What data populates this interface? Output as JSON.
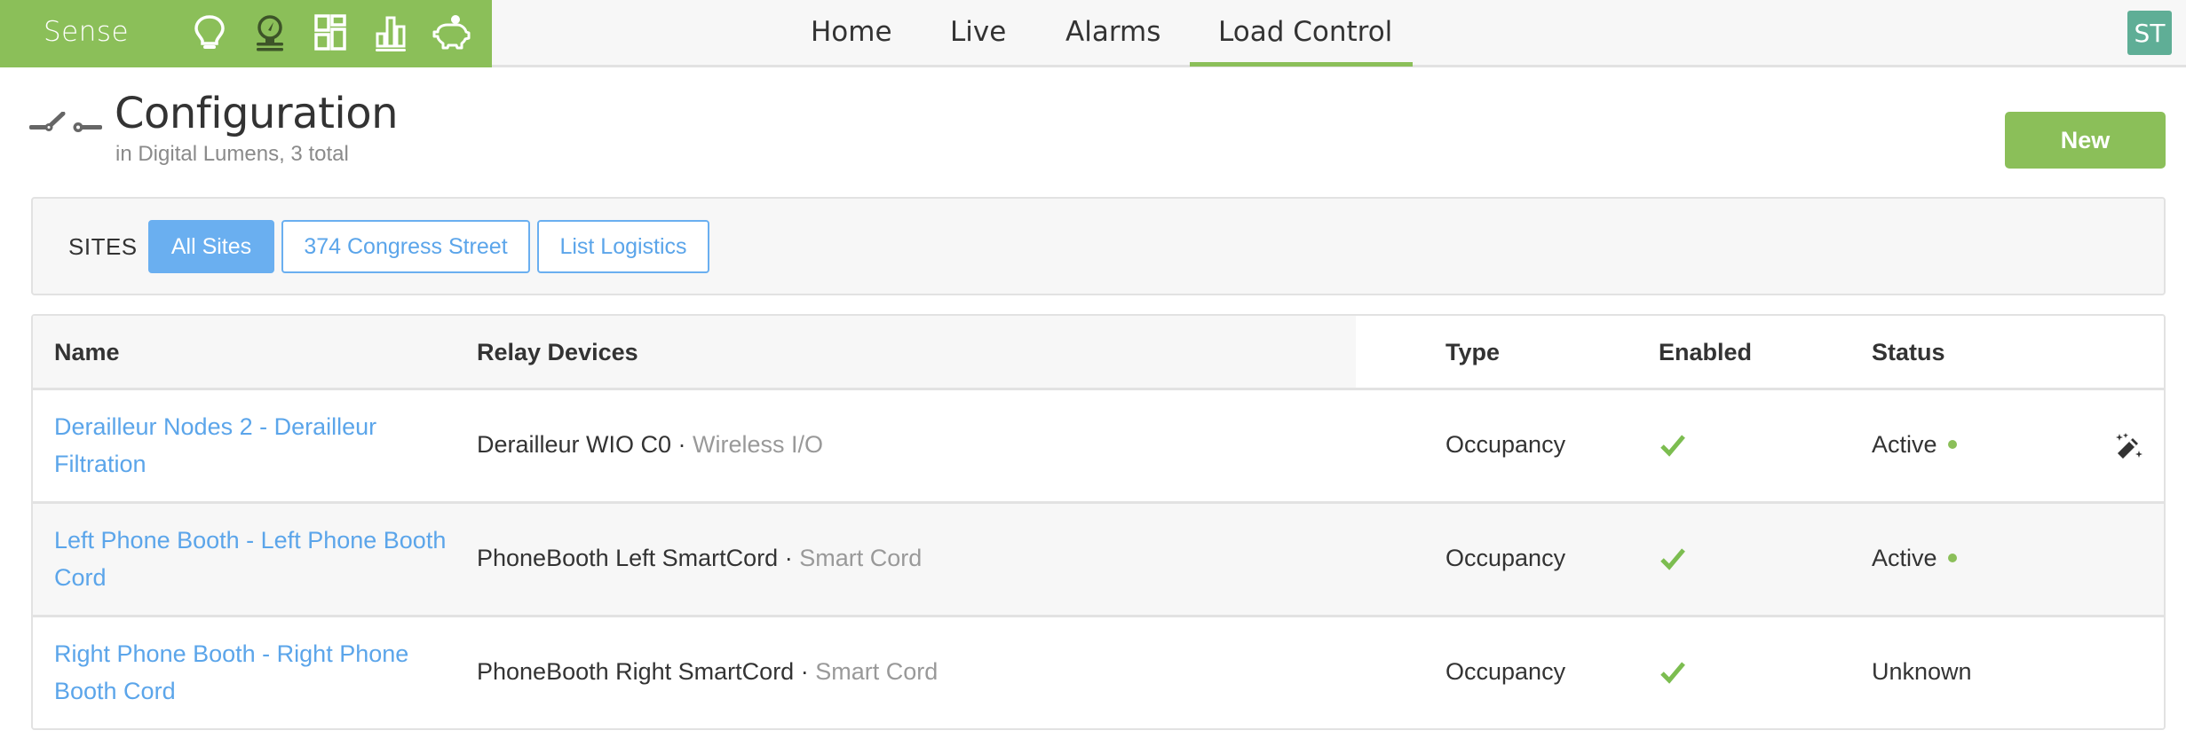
{
  "app": {
    "brand": "Sense",
    "brand_color": "#8bbf59",
    "nav_icons": [
      "lightbulb-icon",
      "gauge-icon",
      "dashboard-grid-icon",
      "bar-chart-icon",
      "piggy-bank-icon"
    ],
    "active_nav_icon": "gauge-icon"
  },
  "nav": {
    "links": [
      {
        "label": "Home"
      },
      {
        "label": "Live"
      },
      {
        "label": "Alarms"
      },
      {
        "label": "Load Control"
      }
    ],
    "active": "Load Control"
  },
  "user": {
    "initials": "ST",
    "avatar_color": "#5fae96"
  },
  "page": {
    "icon": "switch-icon",
    "title": "Configuration",
    "subtitle": "in Digital Lumens, 3 total",
    "new_button": "New"
  },
  "sites": {
    "label": "SITES",
    "options": [
      {
        "label": "All Sites",
        "active": true
      },
      {
        "label": "374 Congress Street",
        "active": false
      },
      {
        "label": "List Logistics",
        "active": false
      }
    ]
  },
  "table": {
    "columns": [
      "Name",
      "Relay Devices",
      "Type",
      "Enabled",
      "Status"
    ],
    "rows": [
      {
        "name": "Derailleur Nodes 2 - Derailleur Filtration",
        "device": "Derailleur WIO C0",
        "separator": " · ",
        "device_type": "Wireless I/O",
        "type": "Occupancy",
        "enabled": true,
        "status": "Active",
        "status_dot": true,
        "action_icon": "magic-wand-icon"
      },
      {
        "name": "Left Phone Booth - Left Phone Booth Cord",
        "device": "PhoneBooth Left SmartCord",
        "separator": " · ",
        "device_type": "Smart Cord",
        "type": "Occupancy",
        "enabled": true,
        "status": "Active",
        "status_dot": true
      },
      {
        "name": "Right Phone Booth - Right Phone Booth Cord",
        "device": "PhoneBooth Right SmartCord",
        "separator": " · ",
        "device_type": "Smart Cord",
        "type": "Occupancy",
        "enabled": true,
        "status": "Unknown",
        "status_dot": false
      }
    ]
  }
}
